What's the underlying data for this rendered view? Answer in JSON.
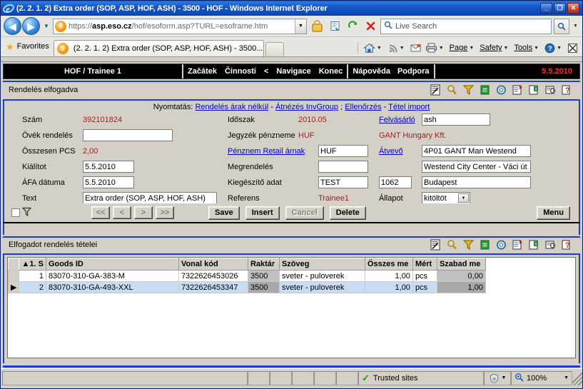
{
  "window": {
    "title": "(2. 2. 1. 2) Extra order (SOP, ASP, HOF, ASH) - 3500 - HOF - Windows Internet Explorer",
    "minimize_label": "_",
    "maximize_label": "❐",
    "close_label": "✕"
  },
  "browser": {
    "back_icon": "◀",
    "forward_icon": "▶",
    "history_caret": "▼",
    "url_scheme": "https://",
    "url_host": "asp.eso.cz",
    "url_path": "/hof/esoform.asp?TURL=esoframe.htm",
    "url_dropdown_icon": "▼",
    "lock_icon": "lock-icon",
    "compat_icon": "compatibility-view-icon",
    "refresh_icon": "↻",
    "stop_icon": "✕",
    "search_placeholder": "Live Search",
    "search_icon": "search-icon",
    "go_icon": "search-icon",
    "favorites_label": "Favorites",
    "favorites_icon": "star-icon",
    "tab_title": "(2. 2. 1. 2) Extra order (SOP, ASP, HOF, ASH) - 3500...",
    "tab_favicon": "eso-icon",
    "commands": [
      {
        "name": "home",
        "label": "",
        "icon": "home-icon",
        "caret": "▼"
      },
      {
        "name": "feeds",
        "label": "",
        "icon": "rss-icon",
        "caret": "▼"
      },
      {
        "name": "mail",
        "label": "",
        "icon": "mail-icon",
        "caret": ""
      },
      {
        "name": "print",
        "label": "",
        "icon": "printer-icon",
        "caret": "▼"
      },
      {
        "name": "page",
        "label": "Page",
        "icon": "",
        "caret": "▼"
      },
      {
        "name": "safety",
        "label": "Safety",
        "icon": "",
        "caret": "▼"
      },
      {
        "name": "tools",
        "label": "Tools",
        "icon": "",
        "caret": "▼"
      },
      {
        "name": "help",
        "label": "",
        "icon": "help-icon",
        "caret": "▼"
      },
      {
        "name": "full-screen",
        "label": "",
        "icon": "fullscreen-icon",
        "caret": ""
      }
    ]
  },
  "app": {
    "user_label": "HOF / Trainee 1",
    "menu": [
      "Začátek",
      "Činnosti",
      "<",
      "Navigace",
      "Konec"
    ],
    "help_menu": [
      "Nápověda",
      "Podpora"
    ],
    "date": "5.5.2010",
    "accent_blue": "#1d3fd0",
    "red": "#ff2a2a"
  },
  "order_section": {
    "title": "Rendelés elfogadva",
    "toolbar_icons": [
      "edit-note-icon",
      "search-icon",
      "filter-icon",
      "refresh-icon",
      "settings-icon",
      "export-doc-icon",
      "export-excel-icon",
      "preview-icon",
      "help-doc-icon"
    ],
    "print_prefix": "Nyomtatás:",
    "print_links": [
      {
        "label": "Rendelés árak nélkül",
        "sep": " - "
      },
      {
        "label": "Átnézés InvGroup",
        "sep": " ; "
      },
      {
        "label": "Ellenőrzés",
        "sep": " - "
      },
      {
        "label": "Tétel import",
        "sep": ""
      }
    ],
    "fields_left": [
      {
        "label": "Szám",
        "value": "392101824",
        "kind": "text-red"
      },
      {
        "label": "Övék rendelés",
        "value": "",
        "kind": "input"
      },
      {
        "label": "Összesen PCS",
        "value": "2,00",
        "kind": "text-red"
      },
      {
        "label": "Kiálítot",
        "value": "5.5.2010",
        "kind": "input"
      },
      {
        "label": "ÁFA dátuma",
        "value": "5.5.2010",
        "kind": "input"
      },
      {
        "label": "Text",
        "value": "Extra order (SOP, ASP, HOF, ASH)",
        "kind": "input"
      }
    ],
    "fields_mid": [
      {
        "label": "Időszak",
        "value": "2010.05",
        "kind": "text-red"
      },
      {
        "label": "Jegyzék pénzneme",
        "value": "HUF",
        "kind": "text-red"
      },
      {
        "label": "Pénznem Retail árnak",
        "value": "HUF",
        "kind": "link-input"
      },
      {
        "label": "Megrendelés",
        "value": "",
        "kind": "input"
      },
      {
        "label": "Kiegészítő adat",
        "value": "TEST",
        "kind": "input"
      },
      {
        "label": "Referens",
        "value": "Trainee1",
        "kind": "text-red"
      }
    ],
    "fields_right": [
      {
        "label": "Felvásárló",
        "value": "ash",
        "kind": "link-input"
      },
      {
        "label": "",
        "value": "GANT Hungary Kft.",
        "kind": "text-red"
      },
      {
        "label": "Átvevő",
        "value": "4P01 GANT Man Westend",
        "kind": "link-input"
      },
      {
        "label": "",
        "value": "Westend City Center - Váci út",
        "kind": "input"
      },
      {
        "label": "",
        "value": "Budapest",
        "kind": "input",
        "extra": "1062"
      },
      {
        "label": "Állapot",
        "value": "kitöltöt",
        "kind": "select"
      }
    ],
    "nav_buttons": [
      "<<",
      "<",
      ">",
      ">>"
    ],
    "action_buttons": [
      {
        "label": "Save",
        "disabled": false
      },
      {
        "label": "Insert",
        "disabled": false
      },
      {
        "label": "Cancel",
        "disabled": true
      },
      {
        "label": "Delete",
        "disabled": false
      }
    ],
    "menu_button": "Menu",
    "filter_checkbox_checked": false,
    "filter_icon": "funnel-icon"
  },
  "items_section": {
    "title": "Elfogadot rendelés tételei",
    "toolbar_icons": [
      "edit-note-icon",
      "search-icon",
      "filter-icon",
      "refresh-icon",
      "settings-icon",
      "export-doc-icon",
      "export-excel-icon",
      "preview-icon",
      "help-doc-icon"
    ],
    "columns": [
      "▲1. S",
      "Goods ID",
      "Vonal kód",
      "Raktár",
      "Szöveg",
      "Összes me",
      "Mért",
      "Szabad me"
    ],
    "rows": [
      {
        "marker": "",
        "selected": false,
        "cells": [
          "1",
          "83070-310-GA-383-M",
          "7322626453026",
          "3500",
          "sveter - puloverek",
          "1,00",
          "pcs",
          "0,00"
        ]
      },
      {
        "marker": "▶",
        "selected": true,
        "cells": [
          "2",
          "83070-310-GA-493-XXL",
          "7322626453347",
          "3500",
          "sveter - puloverek",
          "1,00",
          "pcs",
          "1,00"
        ]
      }
    ]
  },
  "statusbar": {
    "message": "",
    "zone_label": "Trusted sites",
    "zone_icon": "check-icon",
    "protected_icon": "protected-mode-icon",
    "protected_caret": "▼",
    "zoom_icon": "zoom-icon",
    "zoom_level": "100%",
    "zoom_caret": "▼"
  }
}
